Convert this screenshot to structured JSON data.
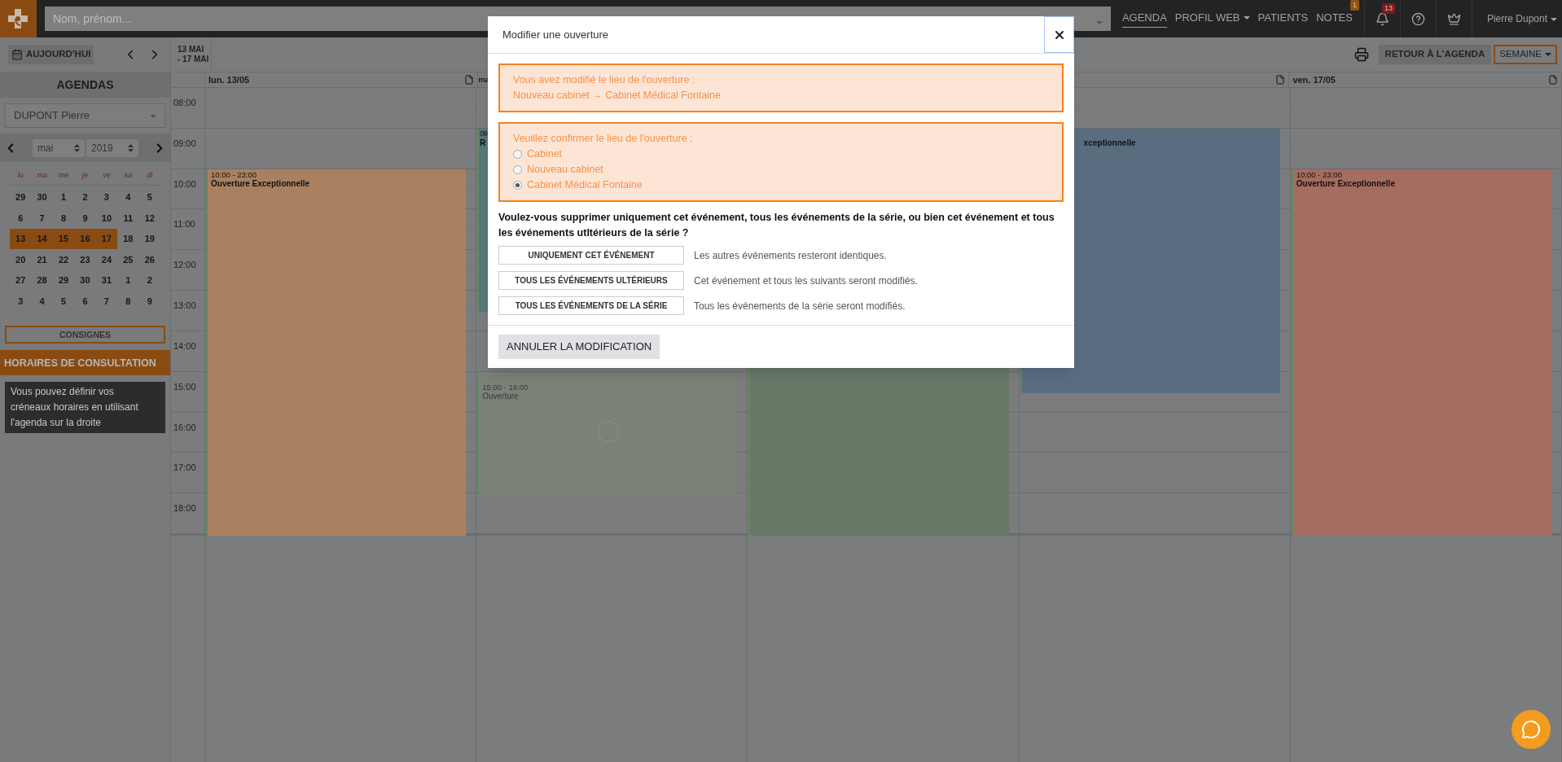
{
  "topbar": {
    "search_placeholder": "Nom, prénom...",
    "nav": [
      {
        "label": "AGENDA",
        "selected": true,
        "dropdown": false
      },
      {
        "label": "PROFIL WEB",
        "selected": false,
        "dropdown": true
      },
      {
        "label": "PATIENTS",
        "selected": false,
        "dropdown": false
      },
      {
        "label": "NOTES",
        "selected": false,
        "dropdown": false,
        "badge": "1"
      }
    ],
    "notifications_badge": "13",
    "user": "Pierre Dupont"
  },
  "sidebar": {
    "today": "AUJOURD'HUI",
    "title": "AGENDAS",
    "agenda": "DUPONT Pierre",
    "month": "mai",
    "year": "2019",
    "weekdays": [
      "lu",
      "ma",
      "me",
      "je",
      "ve",
      "sa",
      "di"
    ],
    "weeks": [
      [
        {
          "label": "29",
          "selected": false
        },
        {
          "label": "30",
          "selected": false
        },
        {
          "label": "1",
          "selected": false
        },
        {
          "label": "2",
          "selected": false
        },
        {
          "label": "3",
          "selected": false
        },
        {
          "label": "4",
          "selected": false
        },
        {
          "label": "5",
          "selected": false
        }
      ],
      [
        {
          "label": "6",
          "selected": false
        },
        {
          "label": "7",
          "selected": false
        },
        {
          "label": "8",
          "selected": false
        },
        {
          "label": "9",
          "selected": false
        },
        {
          "label": "10",
          "selected": false
        },
        {
          "label": "11",
          "selected": false
        },
        {
          "label": "12",
          "selected": false
        }
      ],
      [
        {
          "label": "13",
          "selected": true
        },
        {
          "label": "14",
          "selected": true
        },
        {
          "label": "15",
          "selected": true
        },
        {
          "label": "16",
          "selected": true
        },
        {
          "label": "17",
          "selected": true
        },
        {
          "label": "18",
          "selected": false
        },
        {
          "label": "19",
          "selected": false
        }
      ],
      [
        {
          "label": "20",
          "selected": false
        },
        {
          "label": "21",
          "selected": false
        },
        {
          "label": "22",
          "selected": false
        },
        {
          "label": "23",
          "selected": false
        },
        {
          "label": "24",
          "selected": false
        },
        {
          "label": "25",
          "selected": false
        },
        {
          "label": "26",
          "selected": false
        }
      ],
      [
        {
          "label": "27",
          "selected": false
        },
        {
          "label": "28",
          "selected": false
        },
        {
          "label": "29",
          "selected": false
        },
        {
          "label": "30",
          "selected": false
        },
        {
          "label": "31",
          "selected": false
        },
        {
          "label": "1",
          "selected": false
        },
        {
          "label": "2",
          "selected": false
        }
      ],
      [
        {
          "label": "3",
          "selected": false
        },
        {
          "label": "4",
          "selected": false
        },
        {
          "label": "5",
          "selected": false
        },
        {
          "label": "6",
          "selected": false
        },
        {
          "label": "7",
          "selected": false
        },
        {
          "label": "8",
          "selected": false
        },
        {
          "label": "9",
          "selected": false
        }
      ]
    ],
    "instructions_button": "CONSIGNES",
    "hours_title": "HORAIRES DE CONSULTATION",
    "hours_info": "Vous pouvez définir vos créneaux horaires en utilisant l'agenda sur la droite"
  },
  "calendar": {
    "range": [
      "13 MAI",
      "- 17 MAI"
    ],
    "back_button": "RETOUR À L'AGENDA",
    "view": "SEMAINE",
    "hours": [
      "08:00",
      "09:00",
      "10:00",
      "11:00",
      "12:00",
      "13:00",
      "14:00",
      "15:00",
      "16:00",
      "17:00",
      "18:00"
    ],
    "days": [
      {
        "kind": "full",
        "label": "lun. 13/05",
        "events": [
          {
            "time": "10:00 - 23:00",
            "title": "Ouverture Exceptionnelle",
            "color": "#a98161",
            "kind": "normal"
          }
        ]
      },
      {
        "kind": "cut",
        "label": "ma",
        "events": [
          {
            "time": "09",
            "title": "R",
            "color": "#577878",
            "kind": "cut"
          },
          {
            "time": "15:00 - 18:00",
            "title": "Ouverture",
            "color": "#7b8177",
            "kind": "pending"
          }
        ]
      },
      {
        "kind": "hidden",
        "events": [
          {
            "color": "#687867",
            "kind": "normal"
          }
        ]
      },
      {
        "kind": "icon",
        "events": [
          {
            "title": "xceptionnelle",
            "color": "#5a6d80",
            "kind": "covered"
          }
        ]
      },
      {
        "kind": "full",
        "label": "ven. 17/05",
        "events": [
          {
            "time": "10:00 - 23:00",
            "title": "Ouverture Exceptionnelle",
            "color": "#a56c60",
            "kind": "normal"
          }
        ]
      }
    ]
  },
  "modal": {
    "title": "Modifier une ouverture",
    "notice": [
      "Vous avez modifié le lieu de l'ouverture :",
      "Nouveau cabinet → Cabinet Médical Fontaine"
    ],
    "confirm": {
      "label": "Veuillez confirmer le lieu de l'ouverture :",
      "options": [
        {
          "label": "Cabinet",
          "selected": false
        },
        {
          "label": "Nouveau cabinet",
          "selected": false
        },
        {
          "label": "Cabinet Médical Fontaine",
          "selected": true
        }
      ]
    },
    "question": "Voulez-vous supprimer uniquement cet événement, tous les événements de la série, ou bien cet événement et tous les événements utltérieurs de la série ?",
    "choices": [
      {
        "button": "UNIQUEMENT CET ÉVÉNEMENT",
        "description": "Les autres événements resteront identiques."
      },
      {
        "button": "TOUS LES ÉVÉNEMENTS ULTÉRIEURS",
        "description": "Cet événement et tous les suivants seront modifiés."
      },
      {
        "button": "TOUS LES ÉVÉNEMENTS DE LA SÉRIE",
        "description": "Tous les événements de la série seront modifiés."
      }
    ],
    "cancel": "ANNULER LA MODIFICATION"
  }
}
